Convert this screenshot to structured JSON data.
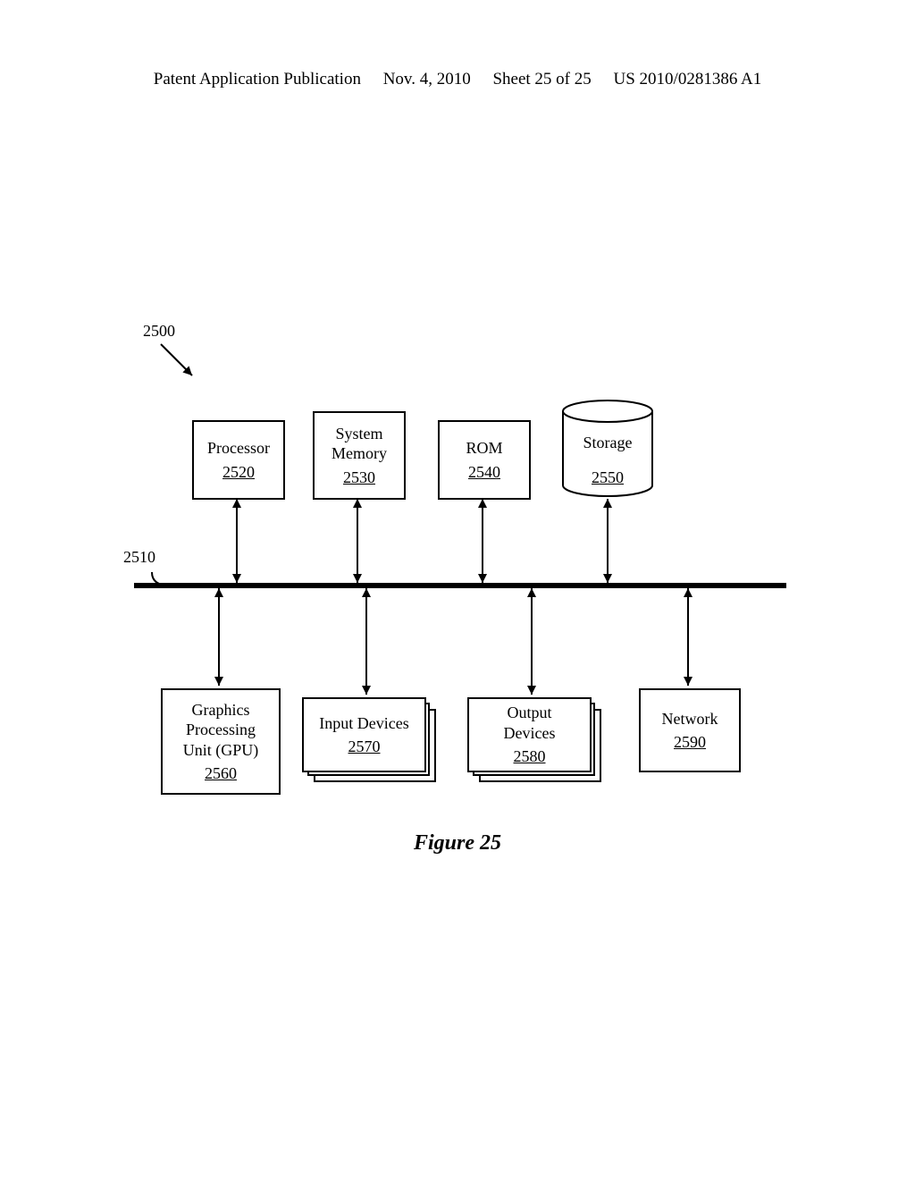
{
  "header": {
    "publication": "Patent Application Publication",
    "date": "Nov. 4, 2010",
    "sheet": "Sheet 25 of 25",
    "docnumber": "US 2010/0281386 A1"
  },
  "labels": {
    "system_ref": "2500",
    "bus_ref": "2510"
  },
  "boxes": {
    "processor": {
      "name": "Processor",
      "ref": "2520"
    },
    "sysmem": {
      "name1": "System",
      "name2": "Memory",
      "ref": "2530"
    },
    "rom": {
      "name": "ROM",
      "ref": "2540"
    },
    "storage": {
      "name": "Storage",
      "ref": "2550"
    },
    "gpu": {
      "name1": "Graphics",
      "name2": "Processing",
      "name3": "Unit (GPU)",
      "ref": "2560"
    },
    "input": {
      "name": "Input Devices",
      "ref": "2570"
    },
    "output": {
      "name1": "Output",
      "name2": "Devices",
      "ref": "2580"
    },
    "network": {
      "name": "Network",
      "ref": "2590"
    }
  },
  "caption": "Figure 25"
}
